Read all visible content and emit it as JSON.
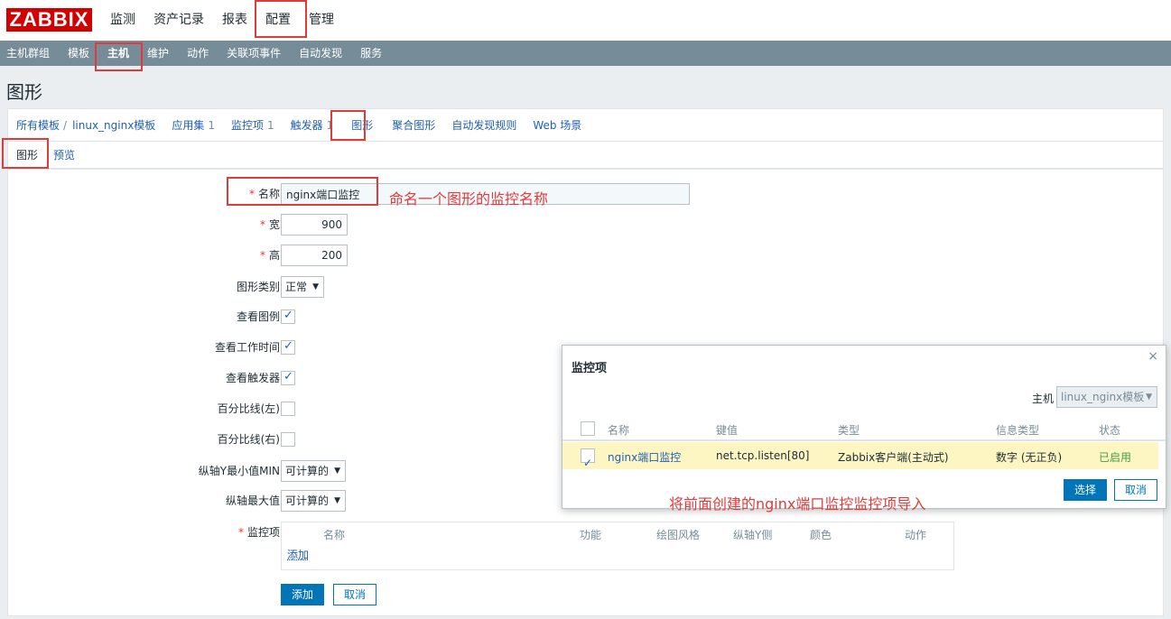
{
  "logo": "ZABBIX",
  "top_menu": [
    "监测",
    "资产记录",
    "报表",
    "配置",
    "管理"
  ],
  "sub_menu": [
    "主机群组",
    "模板",
    "主机",
    "维护",
    "动作",
    "关联项事件",
    "自动发现",
    "服务"
  ],
  "page_title": "图形",
  "breadcrumbs": {
    "all_templates": "所有模板",
    "sep": "/",
    "template": "linux_nginx模板",
    "apps": "应用集",
    "apps_count": "1",
    "items": "监控项",
    "items_count": "1",
    "triggers": "触发器",
    "triggers_count": "1",
    "graphs": "图形",
    "screens": "聚合图形",
    "discovery": "自动发现规则",
    "web": "Web 场景"
  },
  "tabs": [
    "图形",
    "预览"
  ],
  "form": {
    "required_mark": "*",
    "name_label": "名称",
    "name_value": "nginx端口监控",
    "width_label": "宽",
    "width_value": "900",
    "height_label": "高",
    "height_value": "200",
    "type_label": "图形类别",
    "type_value": "正常",
    "legend_label": "查看图例",
    "worktime_label": "查看工作时间",
    "triggers_label": "查看触发器",
    "pct_left_label": "百分比线(左)",
    "pct_right_label": "百分比线(右)",
    "ymin_label": "纵轴Y最小值MIN",
    "ymin_value": "可计算的",
    "ymax_label": "纵轴最大值",
    "ymax_value": "可计算的",
    "items_label": "监控项",
    "items_headers": [
      "名称",
      "功能",
      "绘图风格",
      "纵轴Y侧",
      "颜色",
      "动作"
    ],
    "add_link": "添加",
    "add_button": "添加",
    "cancel_button": "取消"
  },
  "annotations": {
    "name_hint": "命名一个图形的监控名称",
    "import_hint": "将前面创建的nginx端口监控监控项导入"
  },
  "modal": {
    "title": "监控项",
    "close": "×",
    "host_label": "主机",
    "host_value": "linux_nginx模板",
    "headers": [
      "名称",
      "键值",
      "类型",
      "信息类型",
      "状态"
    ],
    "row": {
      "name": "nginx端口监控",
      "key": "net.tcp.listen[80]",
      "type": "Zabbix客户端(主动式)",
      "info_type": "数字 (无正负)",
      "status": "已启用"
    },
    "select_button": "选择",
    "cancel_button": "取消"
  },
  "colors": {
    "logo_bg": "#d40000",
    "subbar_bg": "#768d99",
    "link": "#1f5fb3",
    "primary_button": "#0275b8",
    "annotation_red": "#e03b3b",
    "selected_row": "#fdf6c3",
    "status_ok": "#429e47"
  }
}
